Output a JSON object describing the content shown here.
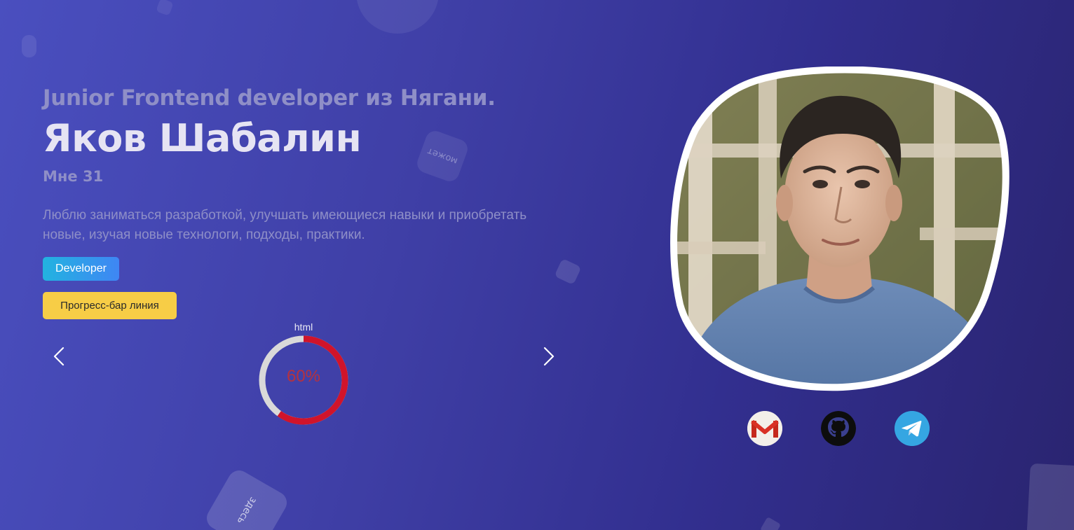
{
  "hero": {
    "subtitle": "Junior Frontend developer из Нягани.",
    "name": "Яков Шабалин",
    "age": "Мне 31",
    "about": "Люблю заниматься разработкой, улучшать имеющиеся навыки и приобретать новые, изучая новые технологи, подходы, практики.",
    "developer_badge": "Developer",
    "progress_button": "Прогресс-бар линия"
  },
  "decorations": {
    "mozhet": "может",
    "zdes": "здесь"
  },
  "skills_slider": {
    "current_skill": "html",
    "percent_text": "60%",
    "percent": 60,
    "ring_color": "#d0142b",
    "track_color": "#d9d9d9"
  },
  "social": [
    {
      "name": "gmail",
      "icon": "gmail-icon"
    },
    {
      "name": "github",
      "icon": "github-icon"
    },
    {
      "name": "telegram",
      "icon": "telegram-icon"
    }
  ],
  "colors": {
    "background_start": "#4a4fbf",
    "background_end": "#2a2470",
    "subtitle": "#8f8fc7",
    "name": "#e6e4f3",
    "developer_badge": "#3f86f4",
    "progress_button": "#f7cd46"
  }
}
